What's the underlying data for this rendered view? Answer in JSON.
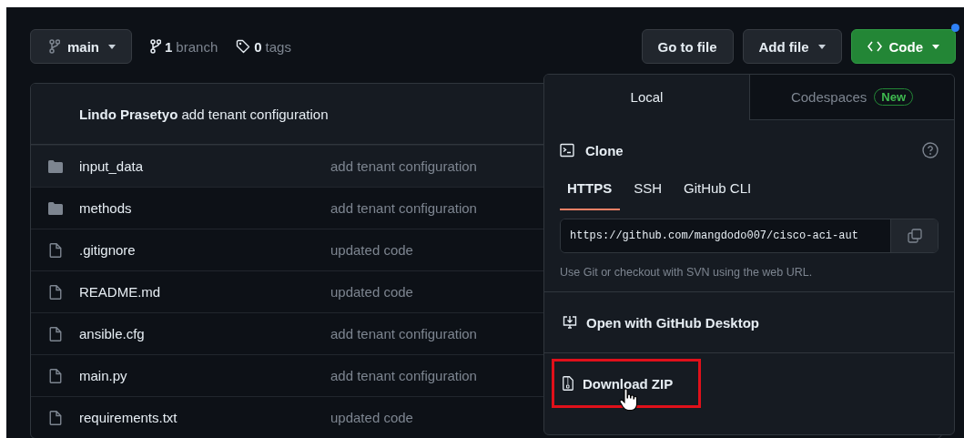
{
  "branch_selector": {
    "label": "main"
  },
  "branch_count": {
    "count": "1",
    "label": "branch"
  },
  "tag_count": {
    "count": "0",
    "label": "tags"
  },
  "actions": [
    {
      "kind": "plain",
      "label": "Go to file",
      "caret": false
    },
    {
      "kind": "plain",
      "label": "Add file",
      "caret": true
    },
    {
      "kind": "primary",
      "label": "Code",
      "caret": true,
      "notification": true
    }
  ],
  "latest_commit": {
    "author": "Lindo Prasetyo",
    "message": "add tenant configuration"
  },
  "files": [
    {
      "kind": "folder",
      "name": "input_data",
      "commit": "add tenant configuration"
    },
    {
      "kind": "folder",
      "name": "methods",
      "commit": "add tenant configuration"
    },
    {
      "kind": "file",
      "name": ".gitignore",
      "commit": "updated code"
    },
    {
      "kind": "file",
      "name": "README.md",
      "commit": "updated code"
    },
    {
      "kind": "file",
      "name": "ansible.cfg",
      "commit": "add tenant configuration"
    },
    {
      "kind": "file",
      "name": "main.py",
      "commit": "add tenant configuration"
    },
    {
      "kind": "file",
      "name": "requirements.txt",
      "commit": "updated code"
    }
  ],
  "code_menu": {
    "tabs": [
      {
        "label": "Local",
        "selected": true
      },
      {
        "label": "Codespaces",
        "selected": false,
        "badge": "New"
      }
    ],
    "clone": {
      "title": "Clone",
      "protocols": [
        {
          "label": "HTTPS",
          "selected": true
        },
        {
          "label": "SSH",
          "selected": false
        },
        {
          "label": "GitHub CLI",
          "selected": false
        }
      ],
      "url": "https://github.com/mangdodo007/cisco-aci-aut",
      "hint": "Use Git or checkout with SVN using the web URL."
    },
    "items": [
      {
        "kind": "desktop",
        "label": "Open with GitHub Desktop",
        "highlighted": false
      },
      {
        "kind": "zip",
        "label": "Download ZIP",
        "highlighted": true
      }
    ]
  }
}
